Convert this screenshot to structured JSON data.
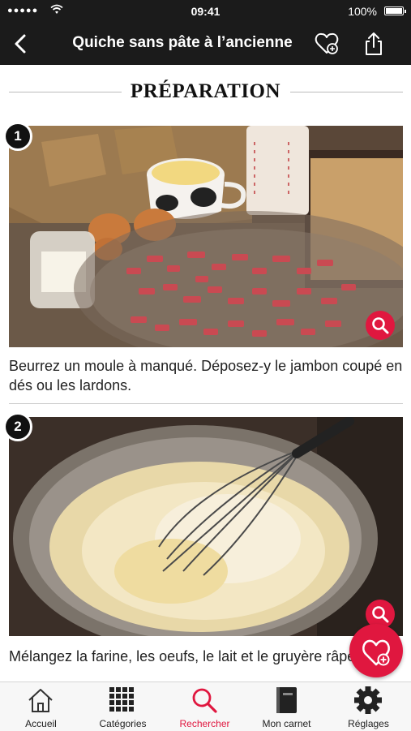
{
  "status_bar": {
    "signal": "●●●●●",
    "time": "09:41",
    "battery": "100%"
  },
  "nav": {
    "title": "Quiche sans pâte à l’ancienne"
  },
  "section": {
    "heading": "PRÉPARATION"
  },
  "steps": [
    {
      "number": "1",
      "text": "Beurrez un moule à manqué. Déposez-y le jambon coupé en dés ou les lardons."
    },
    {
      "number": "2",
      "text": "Mélangez la farine, les oeufs, le lait et le gruyère râpé."
    }
  ],
  "tabbar": [
    {
      "label": "Accueil",
      "icon": "home-icon"
    },
    {
      "label": "Catégories",
      "icon": "grid-icon"
    },
    {
      "label": "Rechercher",
      "icon": "search-icon",
      "active": true
    },
    {
      "label": "Mon carnet",
      "icon": "book-icon"
    },
    {
      "label": "Réglages",
      "icon": "gear-icon"
    }
  ],
  "colors": {
    "accent": "#e0173f",
    "nav_bg": "#1b1b1b"
  }
}
